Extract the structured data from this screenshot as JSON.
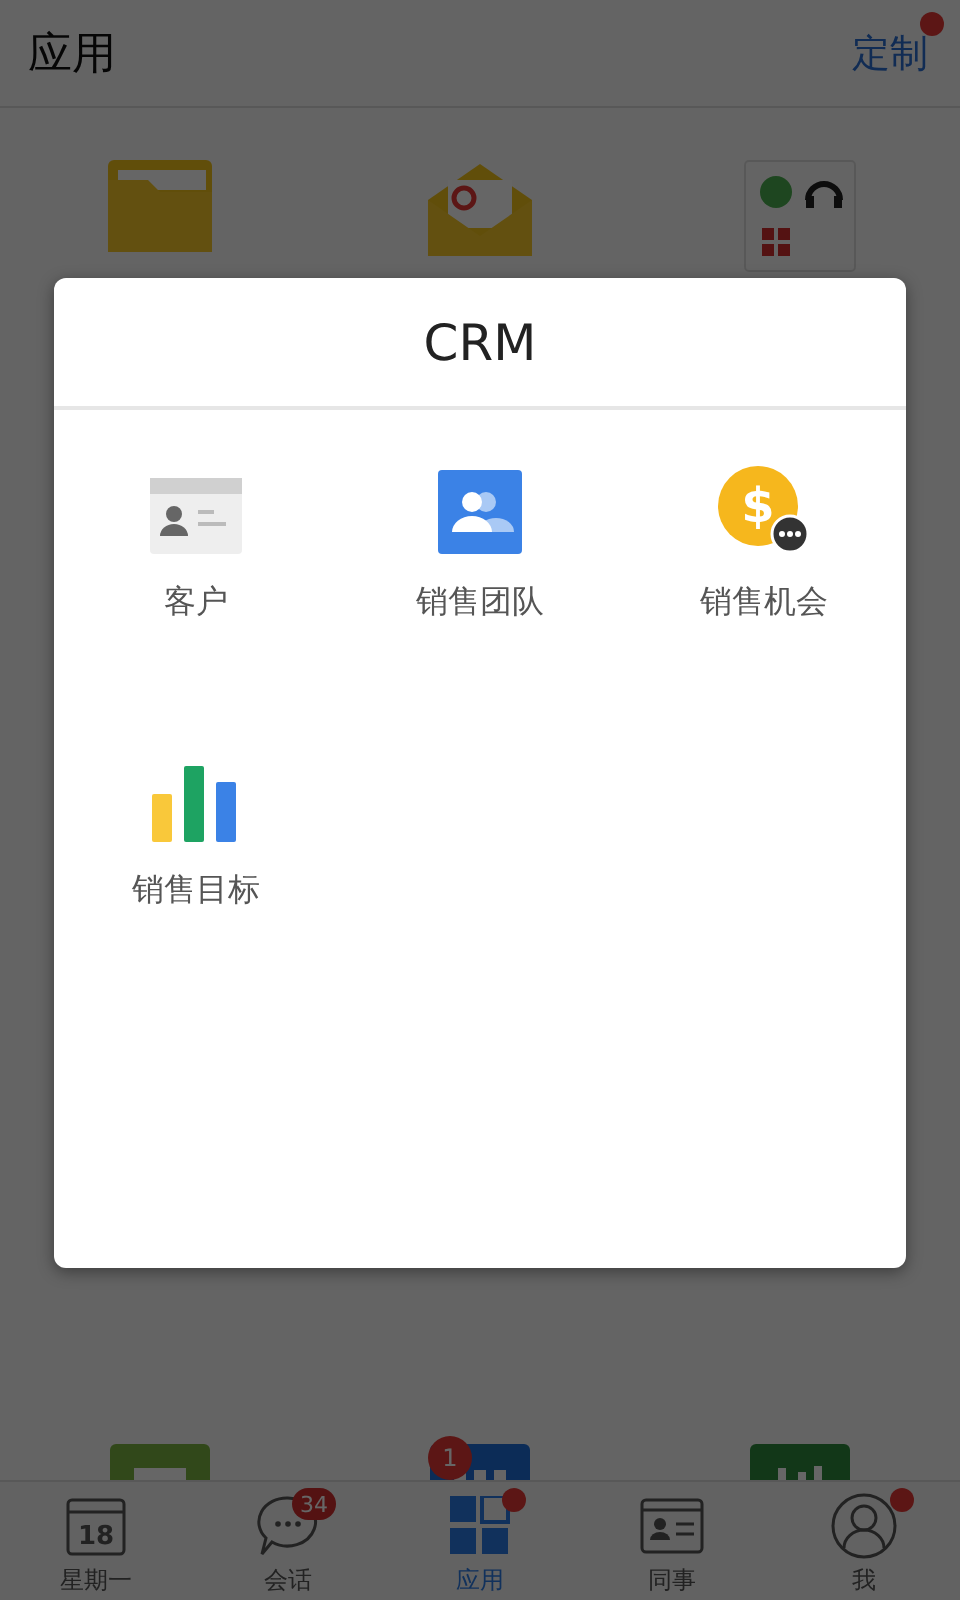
{
  "header": {
    "title": "应用",
    "action": {
      "label": "定制",
      "dot": true
    }
  },
  "apps": [
    {
      "kind": "folder"
    },
    {
      "kind": "mail"
    },
    {
      "kind": "help"
    },
    {
      "kind": "green-tile"
    },
    {
      "kind": "blue-tile",
      "badge": "1"
    },
    {
      "kind": "chart-tile"
    }
  ],
  "dialog": {
    "title": "CRM",
    "items": [
      {
        "kind": "customer",
        "label": "客户"
      },
      {
        "kind": "team",
        "label": "销售团队"
      },
      {
        "kind": "opportunity",
        "label": "销售机会",
        "icon_text": "$"
      },
      {
        "kind": "target",
        "label": "销售目标"
      }
    ]
  },
  "tabs": [
    {
      "kind": "calendar",
      "label": "星期一",
      "icon_text": "18",
      "selected": false,
      "dot": false
    },
    {
      "kind": "chat",
      "label": "会话",
      "badge": "34",
      "selected": false,
      "dot": false
    },
    {
      "kind": "apps",
      "label": "应用",
      "selected": true,
      "dot": true
    },
    {
      "kind": "contacts",
      "label": "同事",
      "selected": false,
      "dot": false
    },
    {
      "kind": "me",
      "label": "我",
      "selected": false,
      "dot": true
    }
  ]
}
